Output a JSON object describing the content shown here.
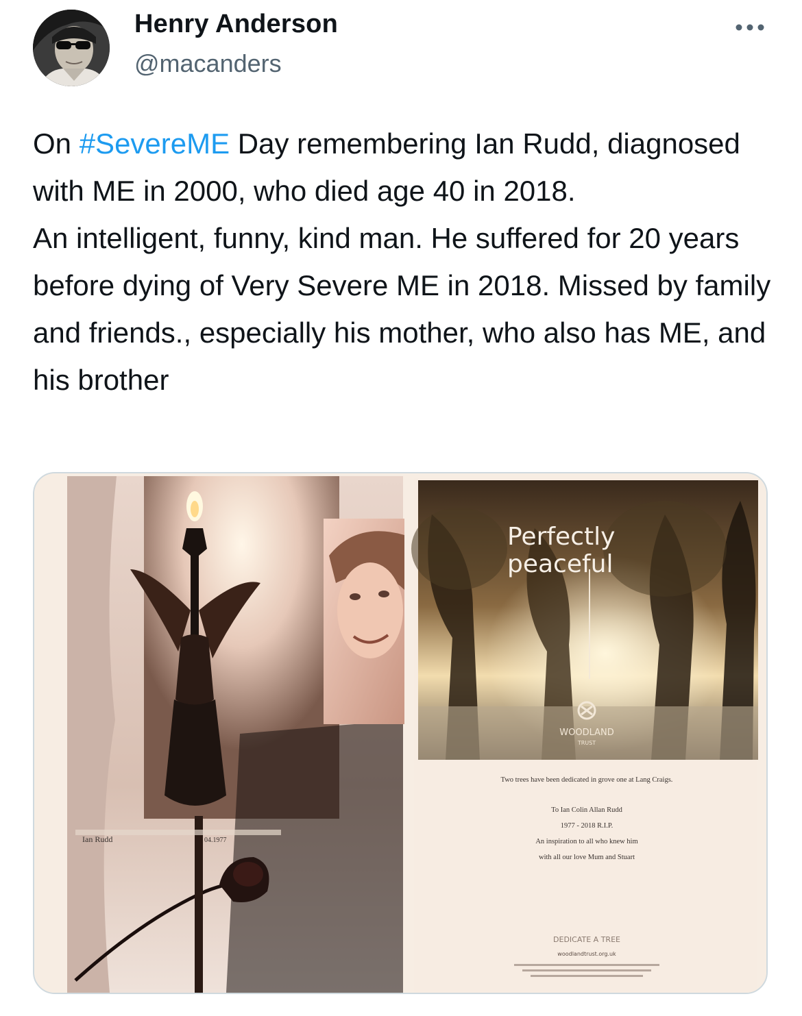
{
  "author": {
    "name": "Henry Anderson",
    "handle": "@macanders",
    "avatar_icon": "person-with-sunglasses-avatar"
  },
  "more_icon": "more-horizontal-icon",
  "tweet": {
    "line1_prefix": "On ",
    "hashtag": "#SevereME",
    "line1_suffix": " Day remembering  Ian Rudd, diagnosed with ME in 2000, who died age 40 in 2018.",
    "paragraph2": "An intelligent, funny, kind man. He  suffered for 20 years before dying of Very Severe ME in 2018. Missed by family and friends., especially his mother, who also has ME, and his brother"
  },
  "media": {
    "left_photo_name": "Ian Rudd",
    "left_photo_date": "04.1977",
    "card_title_line1": "Perfectly",
    "card_title_line2": "peaceful",
    "logo_text": "WOODLAND",
    "logo_sub": "TRUST",
    "dedication_line": "Two trees have been dedicated in grove one at Lang Craigs.",
    "message_line1": "To Ian Colin Allan Rudd",
    "message_line2": "1977 - 2018 R.I.P.",
    "message_line3": "An inspiration to all who knew him",
    "message_line4": "with all our love Mum and Stuart",
    "cta": "DEDICATE A TREE",
    "website": "woodlandtrust.org.uk"
  },
  "colors": {
    "text": "#0f1419",
    "secondary": "#536471",
    "link": "#1d9bf0",
    "border": "#cfd9de"
  }
}
